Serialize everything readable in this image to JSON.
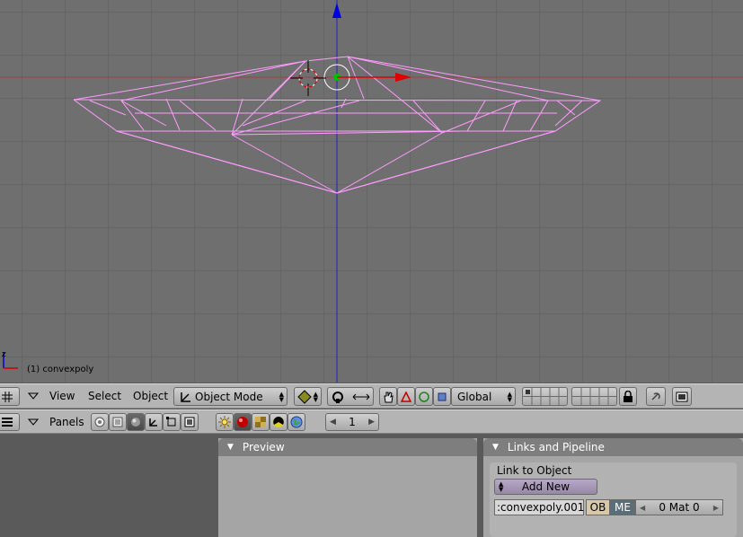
{
  "viewport": {
    "object_label": "(1) convexpoly",
    "colors": {
      "background": "#6f6f6f",
      "grid": "#5e5e5e",
      "wire": "#ff9cff",
      "x_axis": "#d00000",
      "z_axis": "#0000e0"
    }
  },
  "header": {
    "menus": {
      "view": "View",
      "select": "Select",
      "object": "Object"
    },
    "mode": "Object Mode",
    "orientation": "Global"
  },
  "buttons_header": {
    "panels": "Panels",
    "frame": "1"
  },
  "preview_panel": {
    "title": "Preview"
  },
  "links_panel": {
    "title": "Links and Pipeline",
    "link_label": "Link to Object",
    "add_new": "Add New",
    "mesh_name": ":convexpoly.001",
    "ob": "OB",
    "me": "ME",
    "mat": "0 Mat 0"
  }
}
